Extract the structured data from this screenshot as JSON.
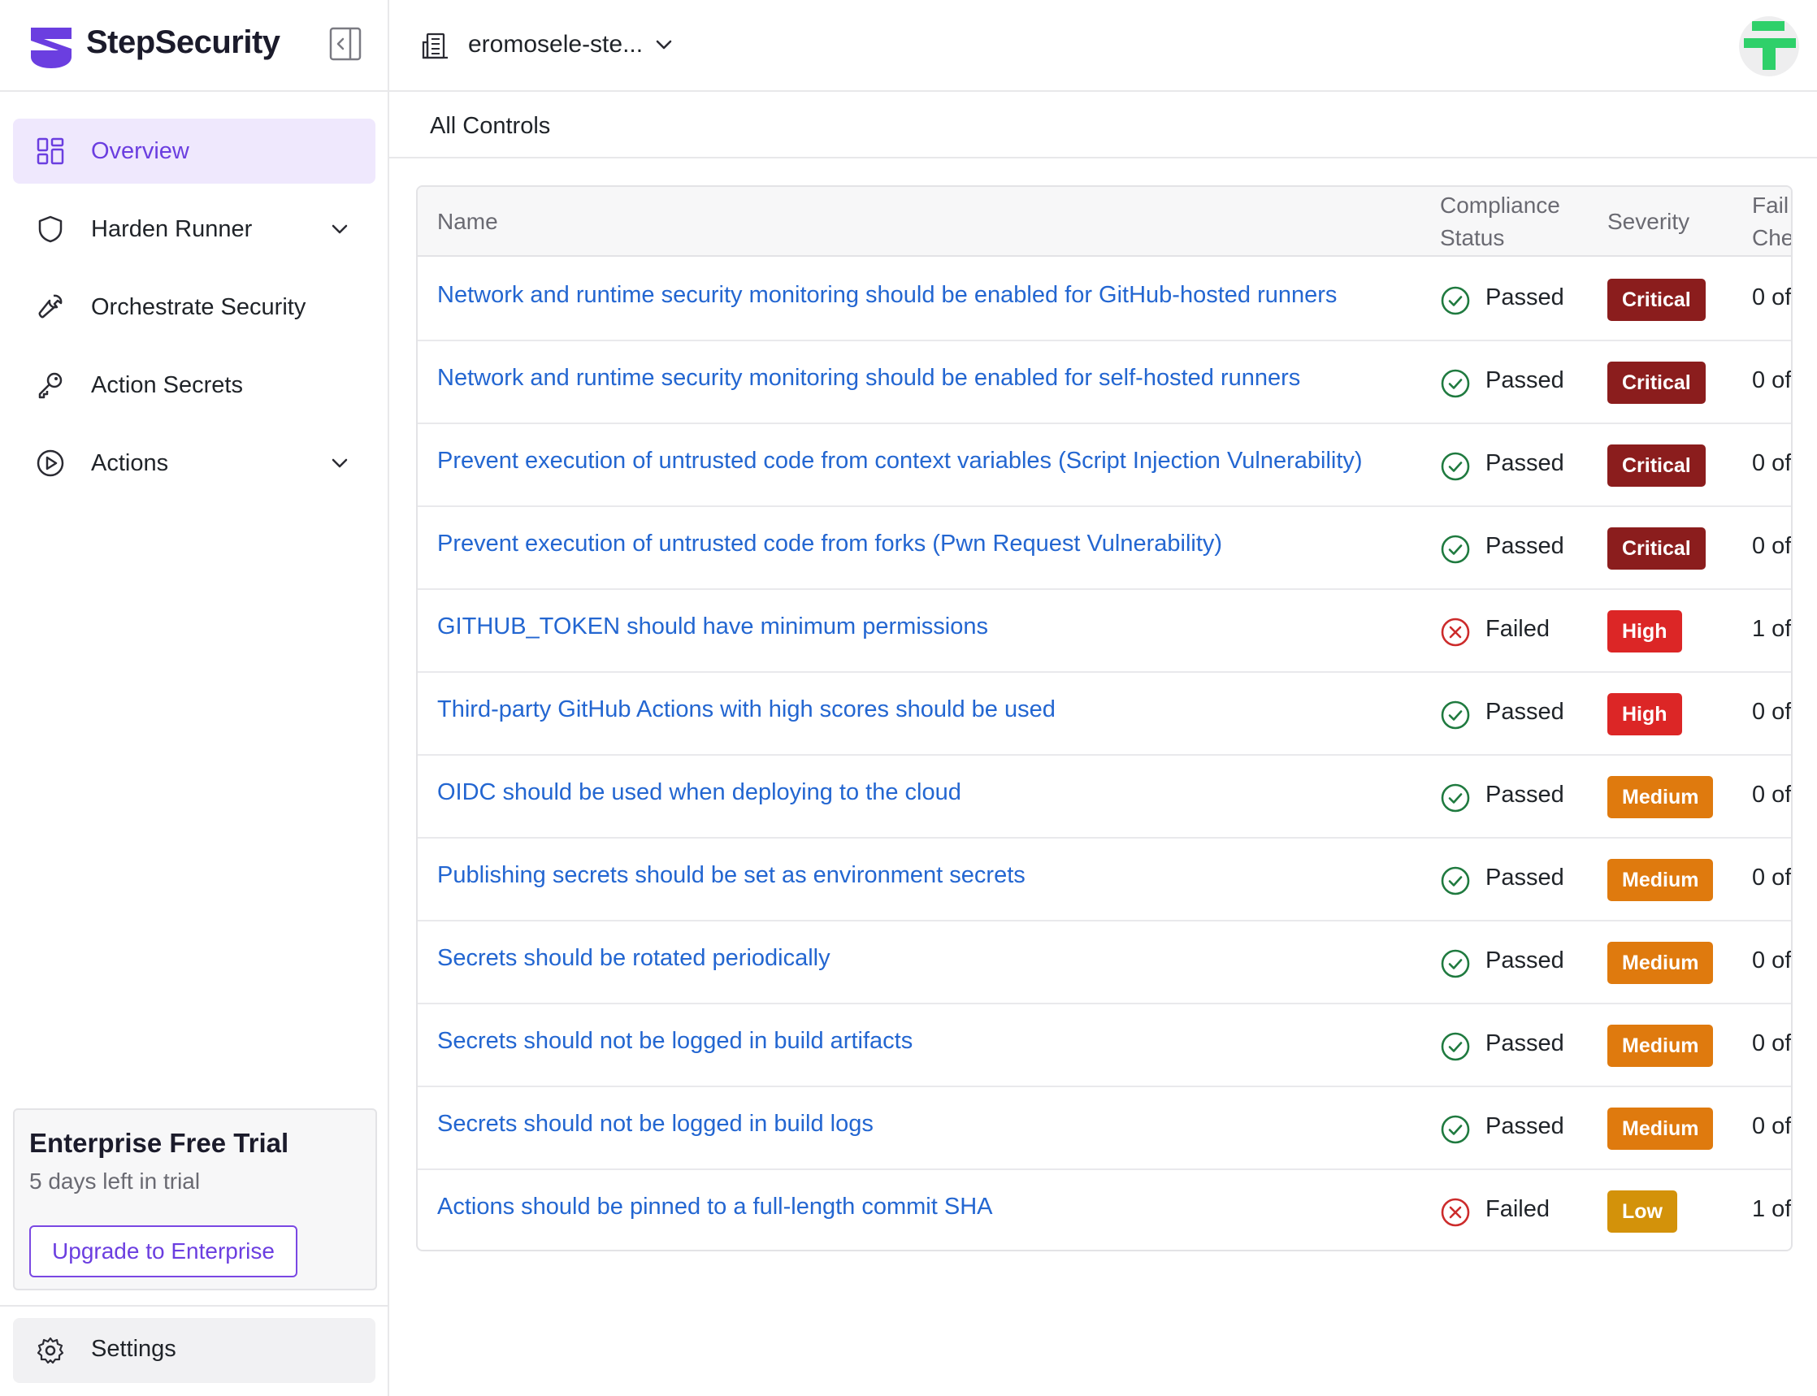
{
  "app": {
    "brand": "StepSecurity"
  },
  "colors": {
    "accent": "#6b3ee0",
    "link": "#2366d1",
    "critical": "#8b1d1d",
    "high": "#dc2626",
    "medium": "#df7a0e",
    "low": "#d3920a",
    "passed": "#1f7a3f",
    "failed": "#cc2b2b"
  },
  "sidebar": {
    "items": [
      {
        "label": "Overview",
        "icon": "grid-icon",
        "active": true
      },
      {
        "label": "Harden Runner",
        "icon": "shield-icon",
        "expandable": true
      },
      {
        "label": "Orchestrate Security",
        "icon": "wrench-icon"
      },
      {
        "label": "Action Secrets",
        "icon": "key-icon"
      },
      {
        "label": "Actions",
        "icon": "play-circle-icon",
        "expandable": true
      }
    ],
    "trial": {
      "title": "Enterprise Free Trial",
      "subtitle": "5 days left in trial",
      "button": "Upgrade to Enterprise"
    },
    "settings": {
      "label": "Settings",
      "icon": "gear-icon"
    }
  },
  "topbar": {
    "org_name": "eromosele-ste...",
    "org_icon": "building-icon"
  },
  "subbar": {
    "title": "All Controls"
  },
  "table": {
    "headers": {
      "name": "Name",
      "compliance_line1": "Compliance",
      "compliance_line2": "Status",
      "severity": "Severity",
      "fail_line1": "Fail",
      "fail_line2": "Che"
    },
    "rows": [
      {
        "name": "Network and runtime security monitoring should be enabled for GitHub-hosted runners",
        "status": "Passed",
        "severity": "Critical",
        "fail": "0 of"
      },
      {
        "name": "Network and runtime security monitoring should be enabled for self-hosted runners",
        "status": "Passed",
        "severity": "Critical",
        "fail": "0 of"
      },
      {
        "name": "Prevent execution of untrusted code from context variables (Script Injection Vulnerability)",
        "status": "Passed",
        "severity": "Critical",
        "fail": "0 of"
      },
      {
        "name": "Prevent execution of untrusted code from forks (Pwn Request Vulnerability)",
        "status": "Passed",
        "severity": "Critical",
        "fail": "0 of"
      },
      {
        "name": "GITHUB_TOKEN should have minimum permissions",
        "status": "Failed",
        "severity": "High",
        "fail": "1 of"
      },
      {
        "name": "Third-party GitHub Actions with high scores should be used",
        "status": "Passed",
        "severity": "High",
        "fail": "0 of"
      },
      {
        "name": "OIDC should be used when deploying to the cloud",
        "status": "Passed",
        "severity": "Medium",
        "fail": "0 of"
      },
      {
        "name": "Publishing secrets should be set as environment secrets",
        "status": "Passed",
        "severity": "Medium",
        "fail": "0 of"
      },
      {
        "name": "Secrets should be rotated periodically",
        "status": "Passed",
        "severity": "Medium",
        "fail": "0 of"
      },
      {
        "name": "Secrets should not be logged in build artifacts",
        "status": "Passed",
        "severity": "Medium",
        "fail": "0 of"
      },
      {
        "name": "Secrets should not be logged in build logs",
        "status": "Passed",
        "severity": "Medium",
        "fail": "0 of"
      },
      {
        "name": "Actions should be pinned to a full-length commit SHA",
        "status": "Failed",
        "severity": "Low",
        "fail": "1 of"
      }
    ]
  }
}
